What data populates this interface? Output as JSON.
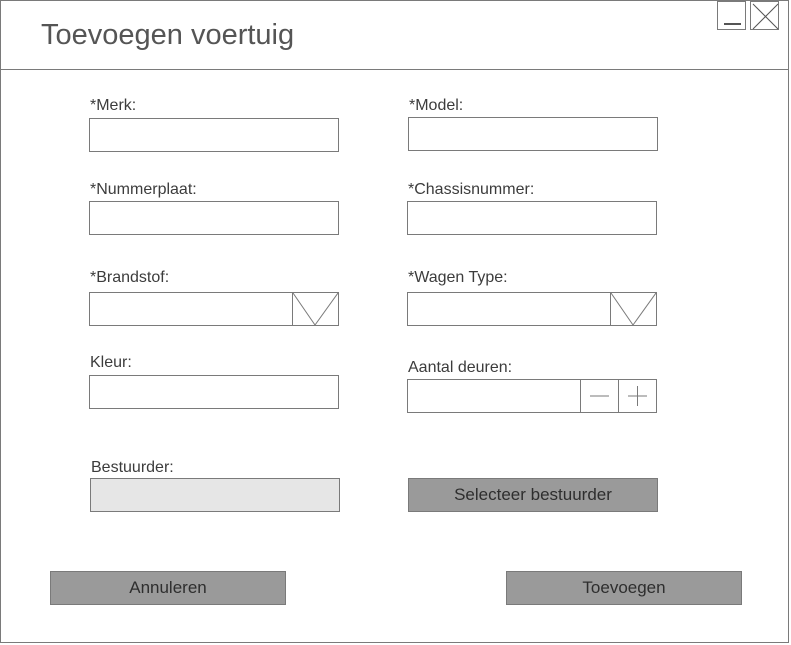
{
  "window": {
    "title": "Toevoegen voertuig",
    "controls": [
      {
        "icon": "minimize-icon"
      },
      {
        "icon": "close-icon"
      }
    ]
  },
  "form": {
    "merk": {
      "label": "*Merk:",
      "value": ""
    },
    "model": {
      "label": "*Model:",
      "value": ""
    },
    "nummerplaat": {
      "label": "*Nummerplaat:",
      "value": ""
    },
    "chassisnummer": {
      "label": "*Chassisnummer:",
      "value": ""
    },
    "brandstof": {
      "label": "*Brandstof:",
      "value": "",
      "icon": "chevron-down-icon"
    },
    "wagen_type": {
      "label": "*Wagen Type:",
      "value": "",
      "icon": "chevron-down-icon"
    },
    "kleur": {
      "label": "Kleur:",
      "value": ""
    },
    "aantal_deuren": {
      "label": "Aantal deuren:",
      "value": ""
    },
    "bestuurder": {
      "label": "Bestuurder:",
      "value": ""
    }
  },
  "buttons": {
    "select_driver": "Selecteer bestuurder",
    "cancel": "Annuleren",
    "add": "Toevoegen"
  },
  "colors": {
    "border": "#7a7a7a",
    "button_bg": "#9a9a9a",
    "readonly_bg": "#e6e6e6"
  }
}
